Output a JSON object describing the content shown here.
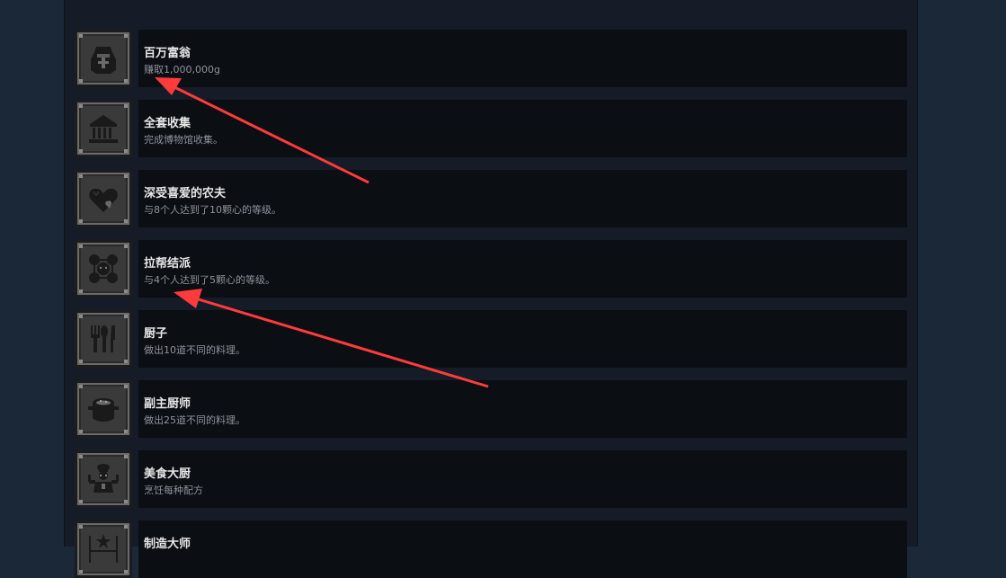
{
  "colors": {
    "page_bg": "#1b2838",
    "panel_bg": "#151c27",
    "row_bg": "#0b0e13",
    "title": "#e6e6e6",
    "desc": "#8e949b",
    "arrow": "#ff3b3b"
  },
  "achievements": [
    {
      "title": "百万富翁",
      "desc": "赚取1,000,000g",
      "icon": "money-bag-icon"
    },
    {
      "title": "全套收集",
      "desc": "完成博物馆收集。",
      "icon": "museum-icon"
    },
    {
      "title": "深受喜爱的农夫",
      "desc": "与8个人达到了10颗心的等级。",
      "icon": "hearts-icon"
    },
    {
      "title": "拉帮结派",
      "desc": "与4个人达到了5颗心的等级。",
      "icon": "friends-group-icon"
    },
    {
      "title": "厨子",
      "desc": "做出10道不同的料理。",
      "icon": "utensils-icon"
    },
    {
      "title": "副主厨师",
      "desc": "做出25道不同的料理。",
      "icon": "cooking-pot-icon"
    },
    {
      "title": "美食大厨",
      "desc": "烹饪每种配方",
      "icon": "chef-icon"
    },
    {
      "title": "制造大师",
      "desc": "",
      "icon": "crafting-icon"
    }
  ]
}
